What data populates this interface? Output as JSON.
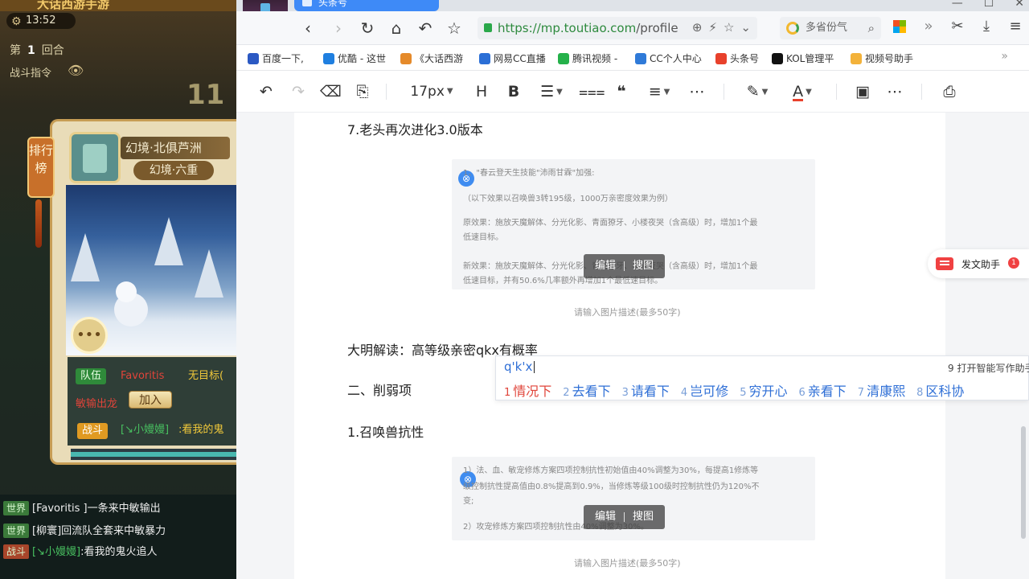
{
  "game": {
    "title": "大话西游手游",
    "clock": "13:52",
    "round_prefix": "第",
    "round_number": "1",
    "round_suffix": "回合",
    "battle_cmd": "战斗指令",
    "big_number": "11",
    "rank_banner": "排行榜",
    "location_title": "幻境·北俱芦洲",
    "location_level": "幻境·六重",
    "chat": {
      "team_chip": "队伍",
      "team_name": "Favoritis",
      "team_rest": "无目标(",
      "line2": "敏输出龙",
      "join_button": "加入",
      "fight_chip": "战斗",
      "fight_user": "[↘小嫚嫚]",
      "fight_text": ":看我的鬼"
    },
    "log": [
      {
        "tag": "世界",
        "name": "[Favoritis ]",
        "text": "一条来中敏输出"
      },
      {
        "tag": "世界",
        "name": "[柳寰]",
        "text": "回流队全套来中敏暴力"
      },
      {
        "tag": "战斗",
        "name": "[↘小嫚嫚]",
        "text": ":看我的鬼火追人"
      }
    ]
  },
  "browser": {
    "tab_title": "头条号",
    "url_host": "https://mp.toutiao.com",
    "url_path": "/profile",
    "search_placeholder": "多省份气",
    "bookmarks": [
      {
        "label": "百度一下,",
        "color": "#2b59c3"
      },
      {
        "label": "优酷 - 这世",
        "color": "#1f7fe0"
      },
      {
        "label": "《大话西游",
        "color": "#e58a2a"
      },
      {
        "label": "网易CC直播",
        "color": "#2b6fd6"
      },
      {
        "label": "腾讯视频 -",
        "color": "#25b14a"
      },
      {
        "label": "CC个人中心",
        "color": "#2f7ad8"
      },
      {
        "label": "头条号",
        "color": "#e8412c"
      },
      {
        "label": "KOL管理平",
        "color": "#111111"
      },
      {
        "label": "视频号助手",
        "color": "#f3b23a"
      }
    ]
  },
  "toolbar": {
    "font_size": "17px",
    "heading": "H",
    "bold": "B"
  },
  "article": {
    "section7": "7.老头再次进化3.0版本",
    "img1_lines": [
      "1、\"春云登天生技能\"沛雨甘霖\"加强:",
      "（以下效果以召唤兽3转195级，1000万亲密度效果为例）",
      "原效果：施放天魔解体、分光化影、青面獠牙、小楼夜哭（含高级）时，增加1个最",
      "低速目标。",
      "新效果：施放天魔解体、分光化影、青面獠牙、小楼夜哭（含高级）时，增加1个最",
      "低速目标，并有50.6%几率额外再增加1个最低速目标。"
    ],
    "img_edit": "编辑",
    "img_search": "搜图",
    "caption": "请输入图片描述(最多50字)",
    "reading": "大明解读：高等级亲密qkx有概率",
    "weaken_title": "二、削弱项",
    "sub1": "1.召唤兽抗性",
    "img2_lines": [
      "1）法、血、敏宠修炼方案四项控制抗性初始值由40%调整为30%，每提高1修炼等",
      "级控制抗性提高值由0.8%提高到0.9%，当修炼等级100级时控制抗性仍为120%不",
      "变;",
      "2）攻宠修炼方案四项控制抗性由40%调整为30%。"
    ]
  },
  "ime": {
    "input": "q'k'x",
    "hint": "9 打开智能写作助手",
    "candidates": [
      {
        "n": "1",
        "text": "情况下"
      },
      {
        "n": "2",
        "text": "去看下"
      },
      {
        "n": "3",
        "text": "请看下"
      },
      {
        "n": "4",
        "text": "岂可修"
      },
      {
        "n": "5",
        "text": "穷开心"
      },
      {
        "n": "6",
        "text": "亲看下"
      },
      {
        "n": "7",
        "text": "清康熙"
      },
      {
        "n": "8",
        "text": "区科协"
      }
    ]
  },
  "assistant": {
    "label": "发文助手",
    "badge": "1"
  }
}
